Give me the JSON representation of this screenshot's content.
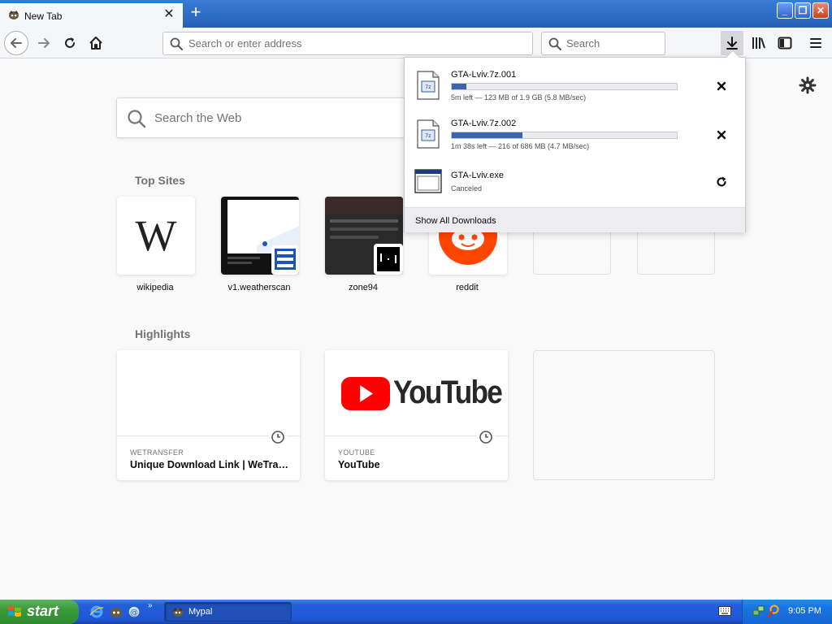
{
  "browser": {
    "tab": {
      "title": "New Tab",
      "close_glyph": "✕"
    },
    "new_tab_glyph": "+",
    "window_buttons": {
      "minimize": "_",
      "maximize": "❐",
      "close": "✕"
    }
  },
  "navbar": {
    "urlbar_placeholder": "Search or enter address",
    "searchbar_placeholder": "Search",
    "icons": [
      "back-icon",
      "forward-icon",
      "reload-icon",
      "home-icon",
      "downloads-icon",
      "library-icon",
      "sidebar-icon",
      "menu-icon"
    ]
  },
  "newtab": {
    "web_search_placeholder": "Search the Web",
    "top_sites_title": "Top Sites",
    "top_sites": [
      {
        "label": "wikipedia"
      },
      {
        "label": "v1.weatherscan"
      },
      {
        "label": "zone94"
      },
      {
        "label": "reddit"
      }
    ],
    "highlights_title": "Highlights",
    "highlights": [
      {
        "source": "WETRANSFER",
        "title": "Unique Download Link | WeTran..."
      },
      {
        "source": "YOUTUBE",
        "title": "YouTube",
        "logo_text": "YouTube"
      }
    ]
  },
  "downloads": {
    "items": [
      {
        "name": "GTA-Lviv.7z.001",
        "status": "5m left — 123 MB of 1.9 GB (5.8 MB/sec)",
        "progress": 0.065,
        "action": "cancel"
      },
      {
        "name": "GTA-Lviv.7z.002",
        "status": "1m 38s left — 216 of 686 MB (4.7 MB/sec)",
        "progress": 0.315,
        "action": "cancel"
      },
      {
        "name": "GTA-Lviv.exe",
        "status": "Canceled",
        "action": "retry"
      }
    ],
    "footer": "Show All Downloads"
  },
  "taskbar": {
    "start_label": "start",
    "quicklaunch_chevron": "»",
    "task_button": "Mypal",
    "clock": "9:05 PM"
  },
  "colors": {
    "accent": "#0a84ff",
    "progress": "#3a63b0",
    "youtube_red": "#ff0000",
    "reddit_orange": "#ff4500",
    "xp_taskbar": "#245edb",
    "xp_start": "#3a9b3a"
  }
}
